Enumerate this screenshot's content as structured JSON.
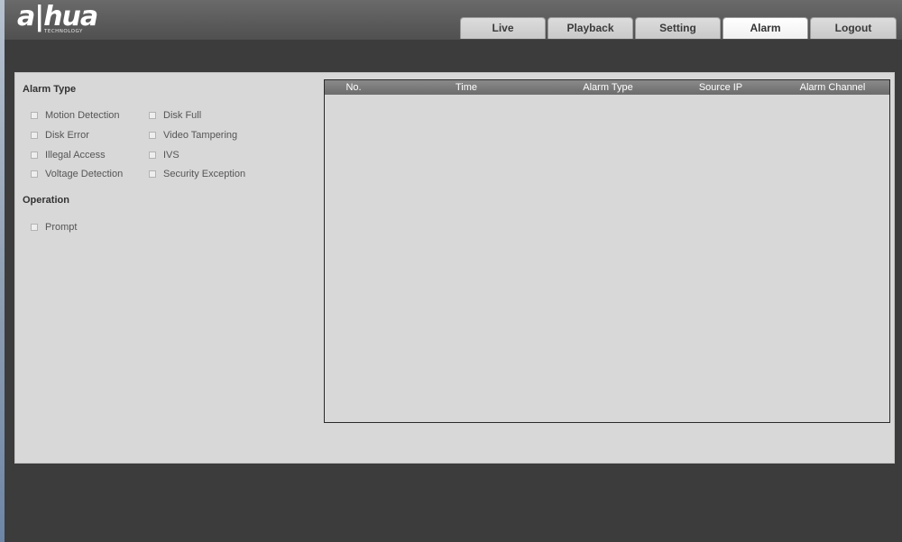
{
  "brand": {
    "logo_text": "a|hua",
    "logo_subtext": "TECHNOLOGY"
  },
  "nav": {
    "tabs": [
      {
        "label": "Live"
      },
      {
        "label": "Playback"
      },
      {
        "label": "Setting"
      },
      {
        "label": "Alarm",
        "active": true
      },
      {
        "label": "Logout"
      }
    ]
  },
  "alarm_type": {
    "title": "Alarm Type",
    "left": [
      "Motion Detection",
      "Disk Error",
      "Illegal Access",
      "Voltage Detection"
    ],
    "right": [
      "Disk Full",
      "Video Tampering",
      "IVS",
      "Security Exception"
    ]
  },
  "operation": {
    "title": "Operation",
    "prompt_label": "Prompt"
  },
  "log_table": {
    "headers": [
      "No.",
      "Time",
      "Alarm Type",
      "Source IP",
      "Alarm Channel"
    ],
    "rows": []
  },
  "colors": {
    "header_bg": "#5a5a5a",
    "page_bg": "#3c3c3c",
    "panel_bg": "#d8d8d8",
    "table_header_bg": "#7a7a7a",
    "active_tab_bg": "#ffffff"
  }
}
